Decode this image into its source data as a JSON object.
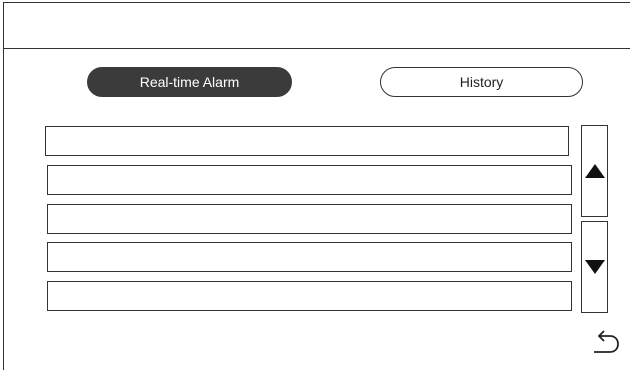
{
  "tabs": {
    "realtime_label": "Real-time Alarm",
    "history_label": "History",
    "active": "realtime"
  },
  "alarm_rows": [
    "",
    "",
    "",
    "",
    ""
  ],
  "icons": {
    "scroll_up": "triangle-up-icon",
    "scroll_down": "triangle-down-icon",
    "back": "back-arrow-icon"
  },
  "colors": {
    "active_tab": "#3b3b3b",
    "border": "#333333",
    "background": "#ffffff"
  }
}
